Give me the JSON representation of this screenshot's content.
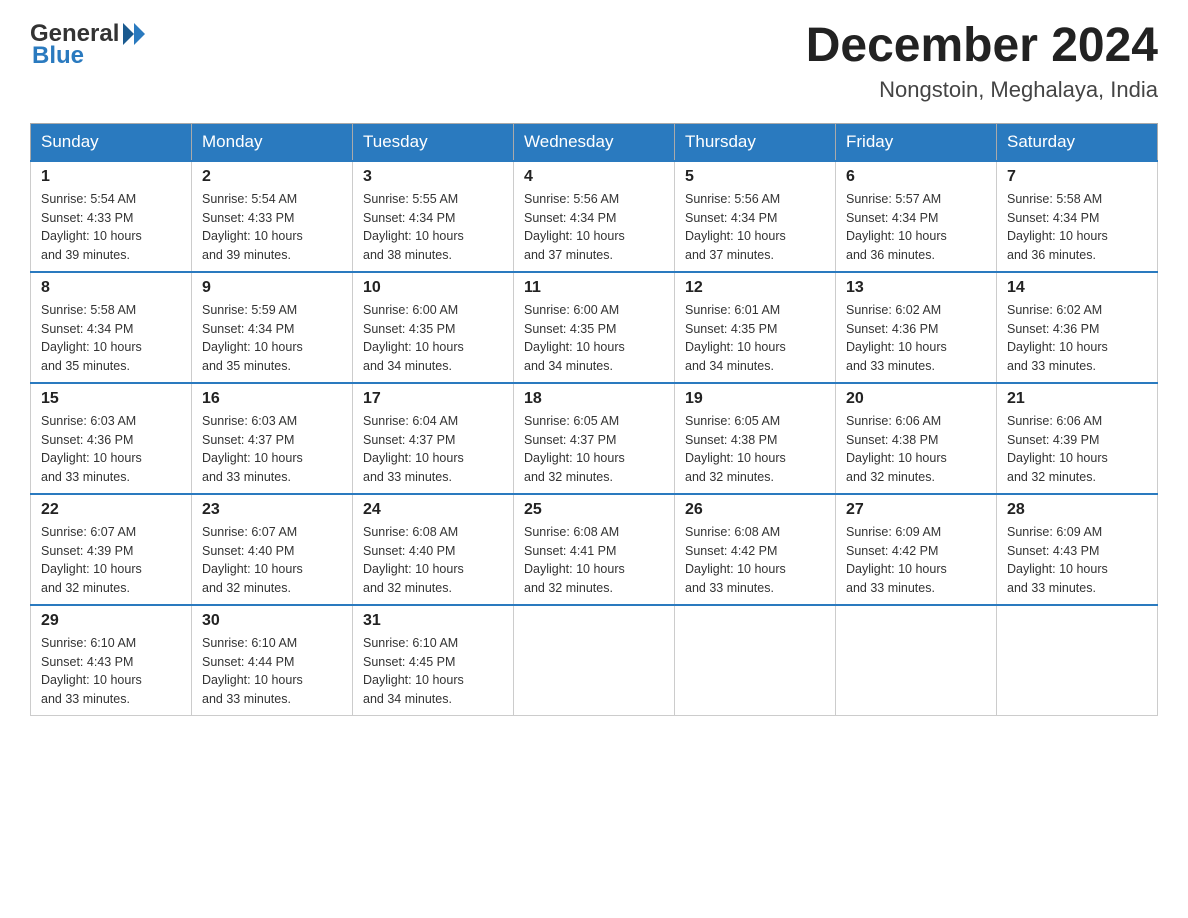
{
  "logo": {
    "general": "General",
    "blue": "Blue"
  },
  "title": "December 2024",
  "location": "Nongstoin, Meghalaya, India",
  "weekdays": [
    "Sunday",
    "Monday",
    "Tuesday",
    "Wednesday",
    "Thursday",
    "Friday",
    "Saturday"
  ],
  "weeks": [
    [
      {
        "day": "1",
        "info": "Sunrise: 5:54 AM\nSunset: 4:33 PM\nDaylight: 10 hours\nand 39 minutes."
      },
      {
        "day": "2",
        "info": "Sunrise: 5:54 AM\nSunset: 4:33 PM\nDaylight: 10 hours\nand 39 minutes."
      },
      {
        "day": "3",
        "info": "Sunrise: 5:55 AM\nSunset: 4:34 PM\nDaylight: 10 hours\nand 38 minutes."
      },
      {
        "day": "4",
        "info": "Sunrise: 5:56 AM\nSunset: 4:34 PM\nDaylight: 10 hours\nand 37 minutes."
      },
      {
        "day": "5",
        "info": "Sunrise: 5:56 AM\nSunset: 4:34 PM\nDaylight: 10 hours\nand 37 minutes."
      },
      {
        "day": "6",
        "info": "Sunrise: 5:57 AM\nSunset: 4:34 PM\nDaylight: 10 hours\nand 36 minutes."
      },
      {
        "day": "7",
        "info": "Sunrise: 5:58 AM\nSunset: 4:34 PM\nDaylight: 10 hours\nand 36 minutes."
      }
    ],
    [
      {
        "day": "8",
        "info": "Sunrise: 5:58 AM\nSunset: 4:34 PM\nDaylight: 10 hours\nand 35 minutes."
      },
      {
        "day": "9",
        "info": "Sunrise: 5:59 AM\nSunset: 4:34 PM\nDaylight: 10 hours\nand 35 minutes."
      },
      {
        "day": "10",
        "info": "Sunrise: 6:00 AM\nSunset: 4:35 PM\nDaylight: 10 hours\nand 34 minutes."
      },
      {
        "day": "11",
        "info": "Sunrise: 6:00 AM\nSunset: 4:35 PM\nDaylight: 10 hours\nand 34 minutes."
      },
      {
        "day": "12",
        "info": "Sunrise: 6:01 AM\nSunset: 4:35 PM\nDaylight: 10 hours\nand 34 minutes."
      },
      {
        "day": "13",
        "info": "Sunrise: 6:02 AM\nSunset: 4:36 PM\nDaylight: 10 hours\nand 33 minutes."
      },
      {
        "day": "14",
        "info": "Sunrise: 6:02 AM\nSunset: 4:36 PM\nDaylight: 10 hours\nand 33 minutes."
      }
    ],
    [
      {
        "day": "15",
        "info": "Sunrise: 6:03 AM\nSunset: 4:36 PM\nDaylight: 10 hours\nand 33 minutes."
      },
      {
        "day": "16",
        "info": "Sunrise: 6:03 AM\nSunset: 4:37 PM\nDaylight: 10 hours\nand 33 minutes."
      },
      {
        "day": "17",
        "info": "Sunrise: 6:04 AM\nSunset: 4:37 PM\nDaylight: 10 hours\nand 33 minutes."
      },
      {
        "day": "18",
        "info": "Sunrise: 6:05 AM\nSunset: 4:37 PM\nDaylight: 10 hours\nand 32 minutes."
      },
      {
        "day": "19",
        "info": "Sunrise: 6:05 AM\nSunset: 4:38 PM\nDaylight: 10 hours\nand 32 minutes."
      },
      {
        "day": "20",
        "info": "Sunrise: 6:06 AM\nSunset: 4:38 PM\nDaylight: 10 hours\nand 32 minutes."
      },
      {
        "day": "21",
        "info": "Sunrise: 6:06 AM\nSunset: 4:39 PM\nDaylight: 10 hours\nand 32 minutes."
      }
    ],
    [
      {
        "day": "22",
        "info": "Sunrise: 6:07 AM\nSunset: 4:39 PM\nDaylight: 10 hours\nand 32 minutes."
      },
      {
        "day": "23",
        "info": "Sunrise: 6:07 AM\nSunset: 4:40 PM\nDaylight: 10 hours\nand 32 minutes."
      },
      {
        "day": "24",
        "info": "Sunrise: 6:08 AM\nSunset: 4:40 PM\nDaylight: 10 hours\nand 32 minutes."
      },
      {
        "day": "25",
        "info": "Sunrise: 6:08 AM\nSunset: 4:41 PM\nDaylight: 10 hours\nand 32 minutes."
      },
      {
        "day": "26",
        "info": "Sunrise: 6:08 AM\nSunset: 4:42 PM\nDaylight: 10 hours\nand 33 minutes."
      },
      {
        "day": "27",
        "info": "Sunrise: 6:09 AM\nSunset: 4:42 PM\nDaylight: 10 hours\nand 33 minutes."
      },
      {
        "day": "28",
        "info": "Sunrise: 6:09 AM\nSunset: 4:43 PM\nDaylight: 10 hours\nand 33 minutes."
      }
    ],
    [
      {
        "day": "29",
        "info": "Sunrise: 6:10 AM\nSunset: 4:43 PM\nDaylight: 10 hours\nand 33 minutes."
      },
      {
        "day": "30",
        "info": "Sunrise: 6:10 AM\nSunset: 4:44 PM\nDaylight: 10 hours\nand 33 minutes."
      },
      {
        "day": "31",
        "info": "Sunrise: 6:10 AM\nSunset: 4:45 PM\nDaylight: 10 hours\nand 34 minutes."
      },
      null,
      null,
      null,
      null
    ]
  ]
}
